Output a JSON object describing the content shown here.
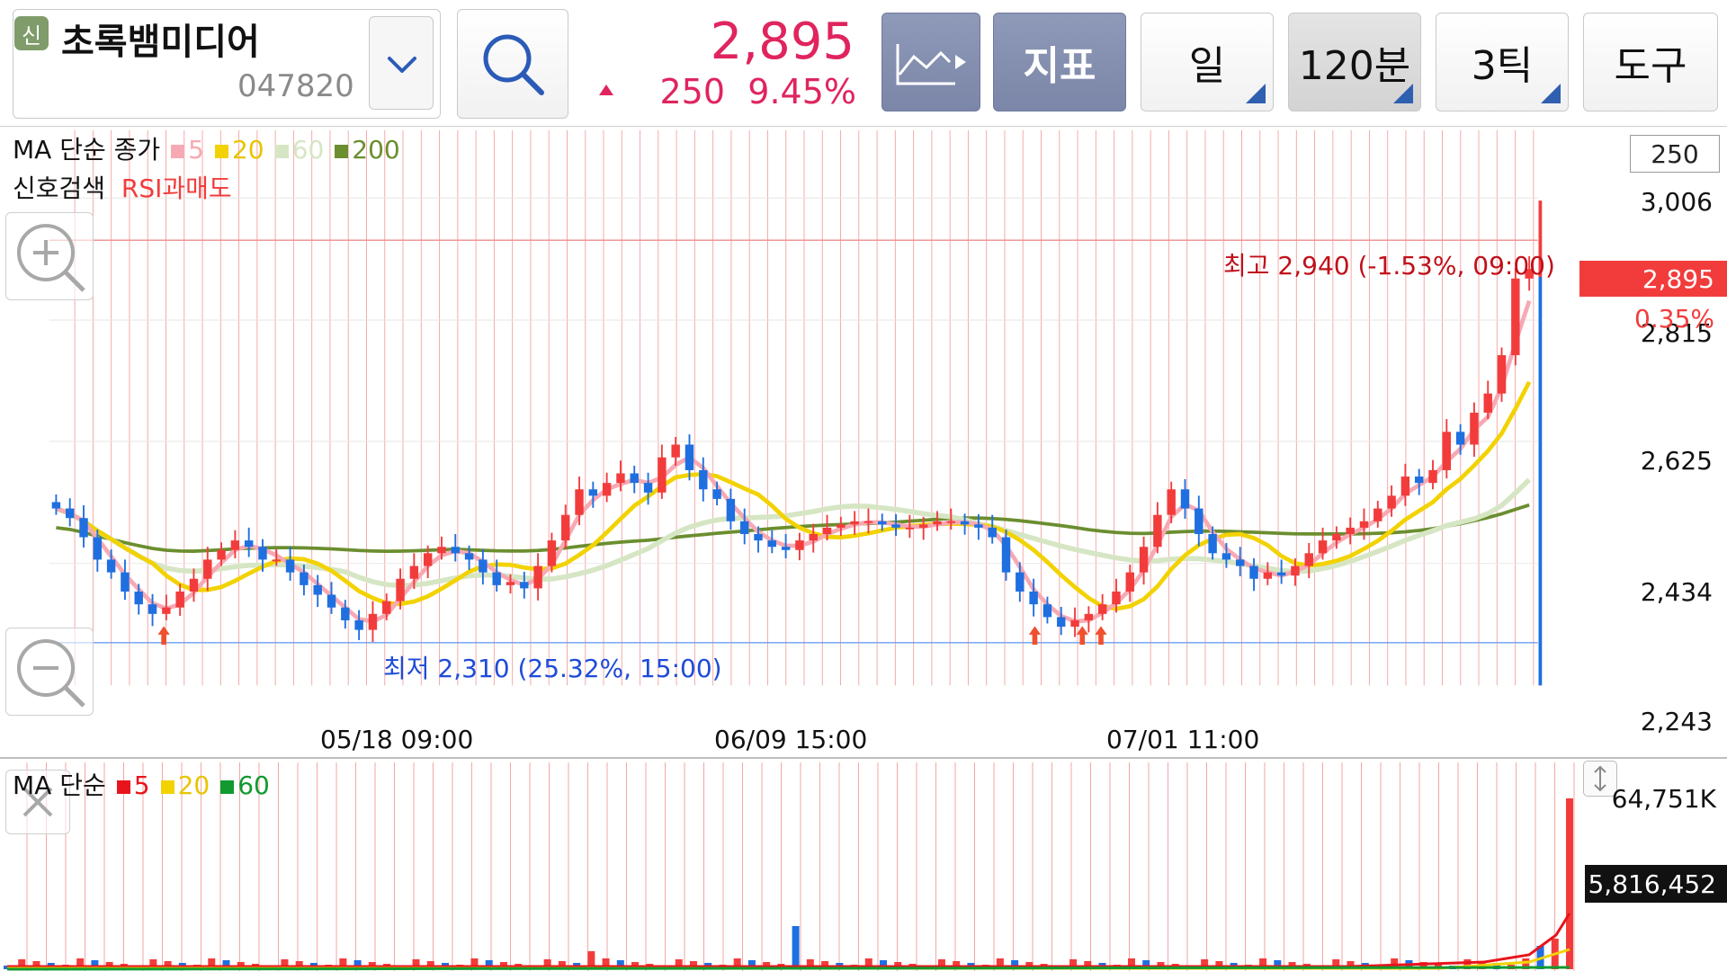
{
  "stock": {
    "badge": "신",
    "name": "초록뱀미디어",
    "code": "047820",
    "price": "2,895",
    "change": "250",
    "change_pct": "9.45%"
  },
  "toolbar": {
    "indicator_label": "지표",
    "period_day": "일",
    "period_min": "120분",
    "period_tick": "3틱",
    "tools": "도구"
  },
  "legend_price": {
    "title": "MA 단순 종가",
    "ma": [
      {
        "label": "5",
        "color": "#f7a9b3"
      },
      {
        "label": "20",
        "color": "#f2d200"
      },
      {
        "label": "60",
        "color": "#d6e6c4"
      },
      {
        "label": "200",
        "color": "#6b8e2f"
      }
    ],
    "signal_title": "신호검색",
    "signal": "RSI과매도"
  },
  "y_axis": {
    "unit": "250",
    "ticks": [
      "3,006",
      "2,815",
      "2,625",
      "2,434",
      "2,243"
    ]
  },
  "x_axis": {
    "ticks": [
      "05/18 09:00",
      "06/09 15:00",
      "07/01 11:00"
    ]
  },
  "markers": {
    "current_price": "2,895",
    "current_pct": "0.35%",
    "high": "최고 2,940 (-1.53%, 09:00)",
    "low": "최저 2,310 (25.32%, 15:00)"
  },
  "legend_volume": {
    "title": "MA 단순",
    "ma": [
      {
        "label": "5",
        "color": "#e8141c"
      },
      {
        "label": "20",
        "color": "#f2d200"
      },
      {
        "label": "60",
        "color": "#119a2f"
      }
    ]
  },
  "volume": {
    "max": "64,751K",
    "current": "5,816,452"
  },
  "colors": {
    "up": "#f23c3c",
    "down": "#1f6fe0",
    "price_text": "#e0245e"
  },
  "chart_data": {
    "type": "candlestick",
    "ylim": [
      2243,
      3006
    ],
    "close": [
      2520,
      2505,
      2475,
      2440,
      2420,
      2390,
      2370,
      2355,
      2365,
      2390,
      2410,
      2440,
      2455,
      2470,
      2460,
      2440,
      2440,
      2420,
      2400,
      2385,
      2365,
      2345,
      2330,
      2355,
      2375,
      2410,
      2430,
      2450,
      2460,
      2450,
      2440,
      2420,
      2400,
      2405,
      2395,
      2430,
      2470,
      2510,
      2550,
      2540,
      2560,
      2575,
      2560,
      2545,
      2600,
      2620,
      2580,
      2550,
      2535,
      2500,
      2480,
      2470,
      2460,
      2455,
      2470,
      2480,
      2490,
      2495,
      2500,
      2500,
      2495,
      2490,
      2490,
      2495,
      2500,
      2500,
      2495,
      2490,
      2475,
      2420,
      2390,
      2370,
      2350,
      2335,
      2345,
      2355,
      2370,
      2390,
      2420,
      2460,
      2510,
      2550,
      2520,
      2480,
      2450,
      2440,
      2430,
      2410,
      2420,
      2415,
      2430,
      2450,
      2470,
      2480,
      2490,
      2500,
      2520,
      2540,
      2570,
      2560,
      2580,
      2640,
      2620,
      2670,
      2700,
      2760,
      2880,
      2895
    ]
  }
}
